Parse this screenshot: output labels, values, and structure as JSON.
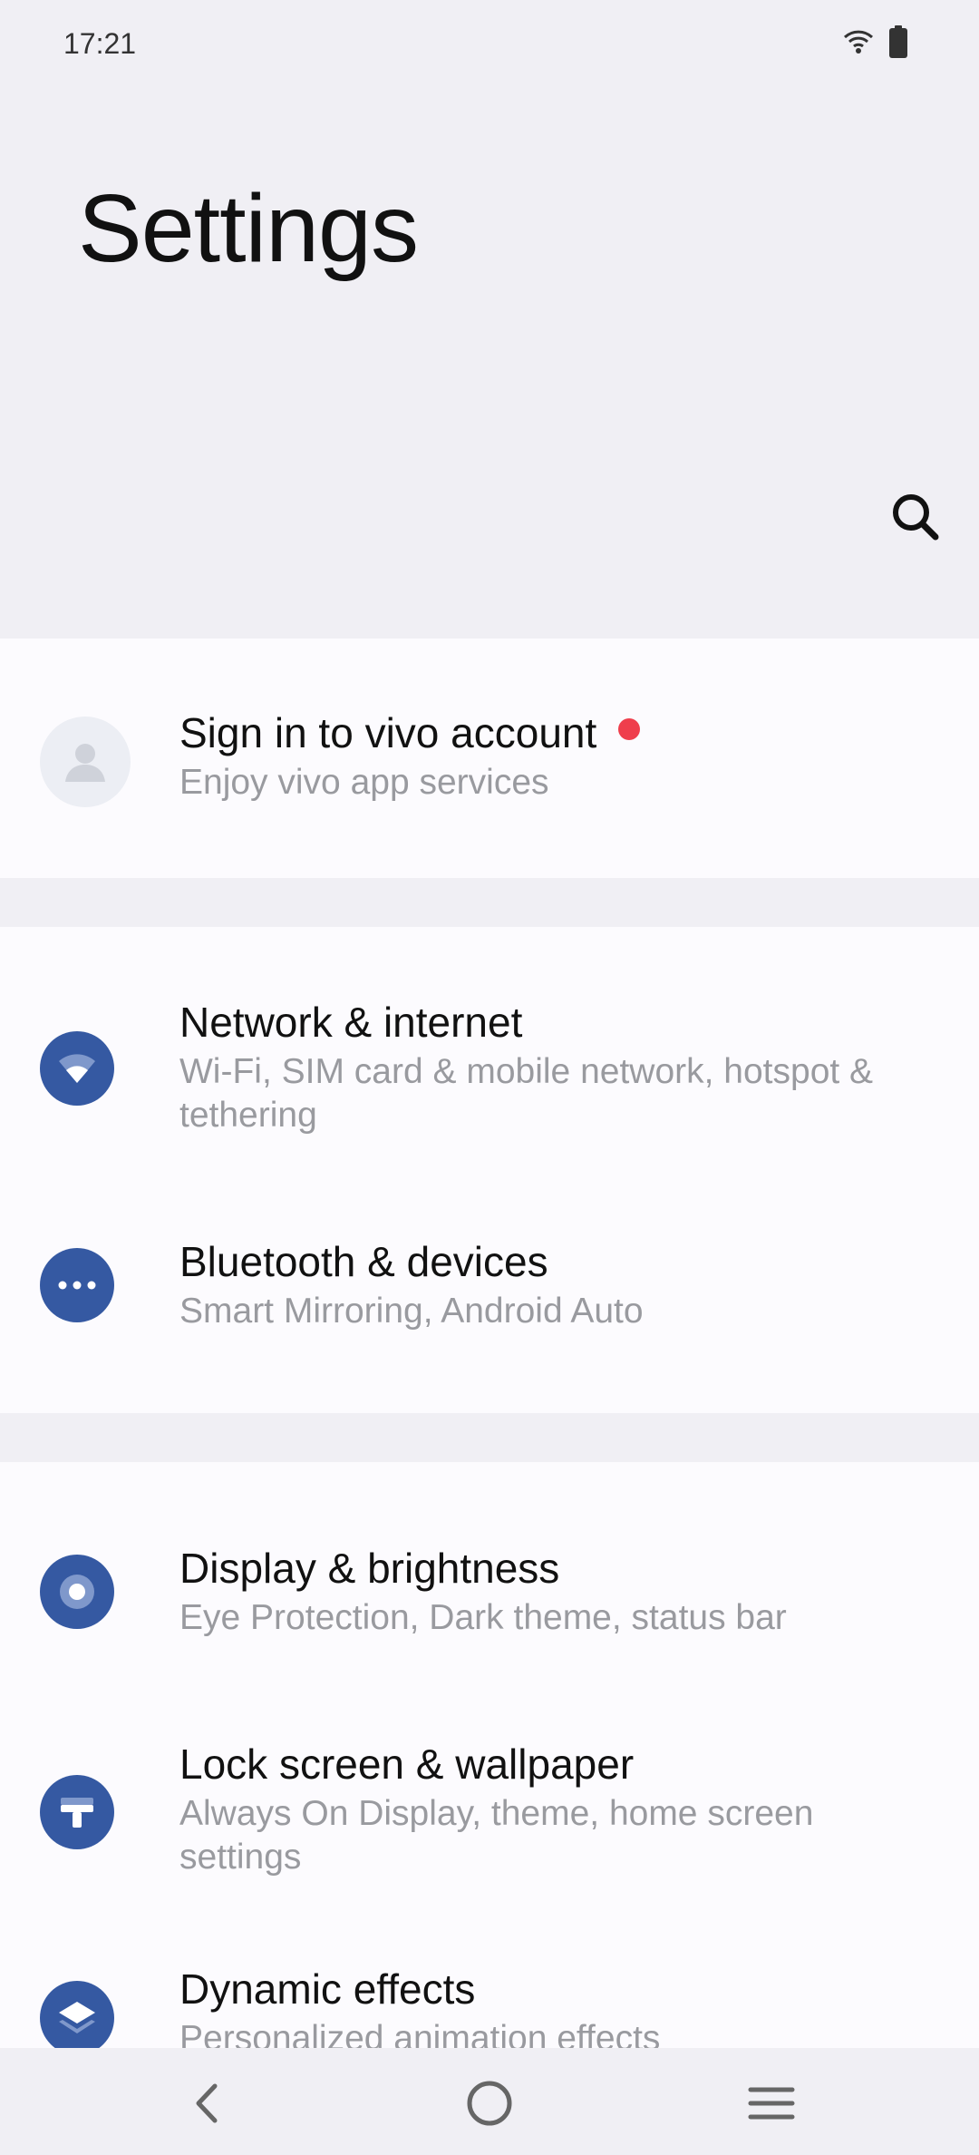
{
  "status_bar": {
    "time": "17:21",
    "icons": [
      "wifi-icon",
      "battery-icon"
    ]
  },
  "header": {
    "title": "Settings"
  },
  "search": {
    "icon": "search-icon"
  },
  "account": {
    "title": "Sign in to vivo account",
    "subtitle": "Enjoy vivo app services",
    "icon": "avatar-icon",
    "badge_color": "#ef3e4c"
  },
  "items": [
    {
      "title": "Network & internet",
      "subtitle": "Wi-Fi, SIM card & mobile network, hotspot & tethering",
      "icon": "wifi-icon"
    },
    {
      "title": "Bluetooth & devices",
      "subtitle": "Smart Mirroring, Android Auto",
      "icon": "more-dots-icon"
    },
    {
      "title": "Display & brightness",
      "subtitle": "Eye Protection, Dark theme, status bar",
      "icon": "brightness-icon"
    },
    {
      "title": "Lock screen & wallpaper",
      "subtitle": "Always On Display, theme, home screen settings",
      "icon": "paint-roller-icon"
    },
    {
      "title": "Dynamic effects",
      "subtitle": "Personalized animation effects",
      "icon": "layers-icon"
    }
  ],
  "nav_bar": {
    "icons": [
      "back-icon",
      "home-icon",
      "menu-icon"
    ]
  },
  "colors": {
    "accent": "#3559a2",
    "background": "#f0eff4",
    "card": "#fcfbfe",
    "subtitle": "#999a9f"
  }
}
